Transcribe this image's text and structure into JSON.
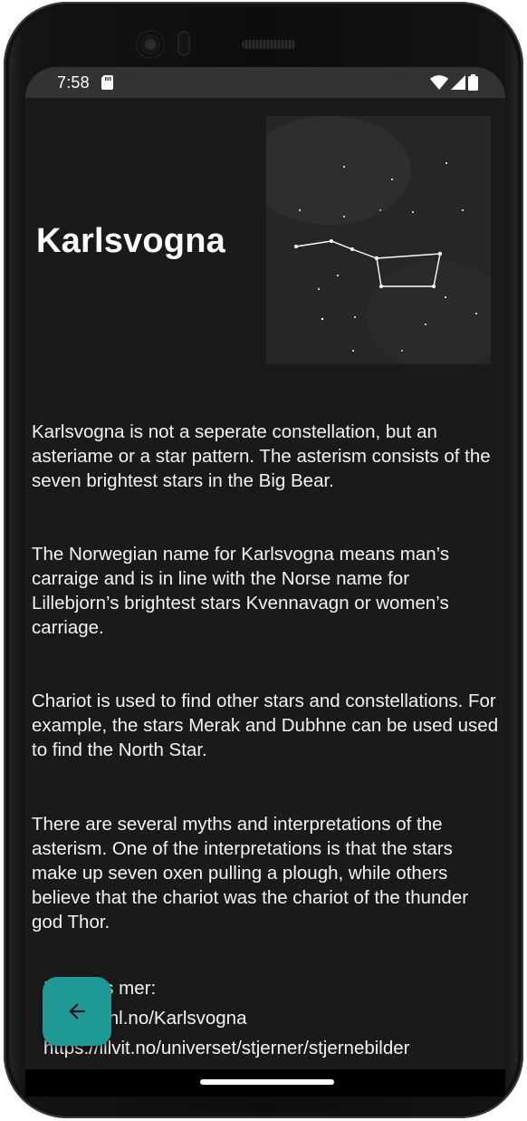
{
  "status_bar": {
    "time": "7:58",
    "icons": [
      "sd-card-icon",
      "wifi-icon",
      "signal-icon",
      "battery-icon"
    ]
  },
  "page": {
    "title": "Karlsvogna",
    "image_icon": "constellation-image",
    "paragraphs": [
      "Karlsvogna is not a seperate constellation, but an asteriame or a star pattern. The asterism consists of the seven brightest stars in the Big Bear.",
      "The Norwegian name for Karlsvogna means man’s carraige and is in line with the Norse name for Lillebjorn’s brightest stars Kvennavagn or women’s carriage.",
      "Chariot is used to find other stars and constellations. For example, the stars Merak and Dubhne can be used used to find the North Star.",
      "There are several myths and interpretations of the asterism. One of the interpretations is that the stars make up seven oxen pulling a plough, while others believe that the chariot was the chariot of the thunder god Thor."
    ],
    "read_more": {
      "heading": "Kilde/les mer:",
      "links": [
        "https://snl.no/Karlsvogna",
        "https://illvit.no/universet/stjerner/stjernebilder"
      ]
    }
  },
  "fab": {
    "icon": "arrow-left-icon",
    "color": "#1f9a99"
  },
  "colors": {
    "background": "#1a1a1a",
    "status_bar": "#333333",
    "text": "#ffffff",
    "accent": "#1f9a99"
  }
}
